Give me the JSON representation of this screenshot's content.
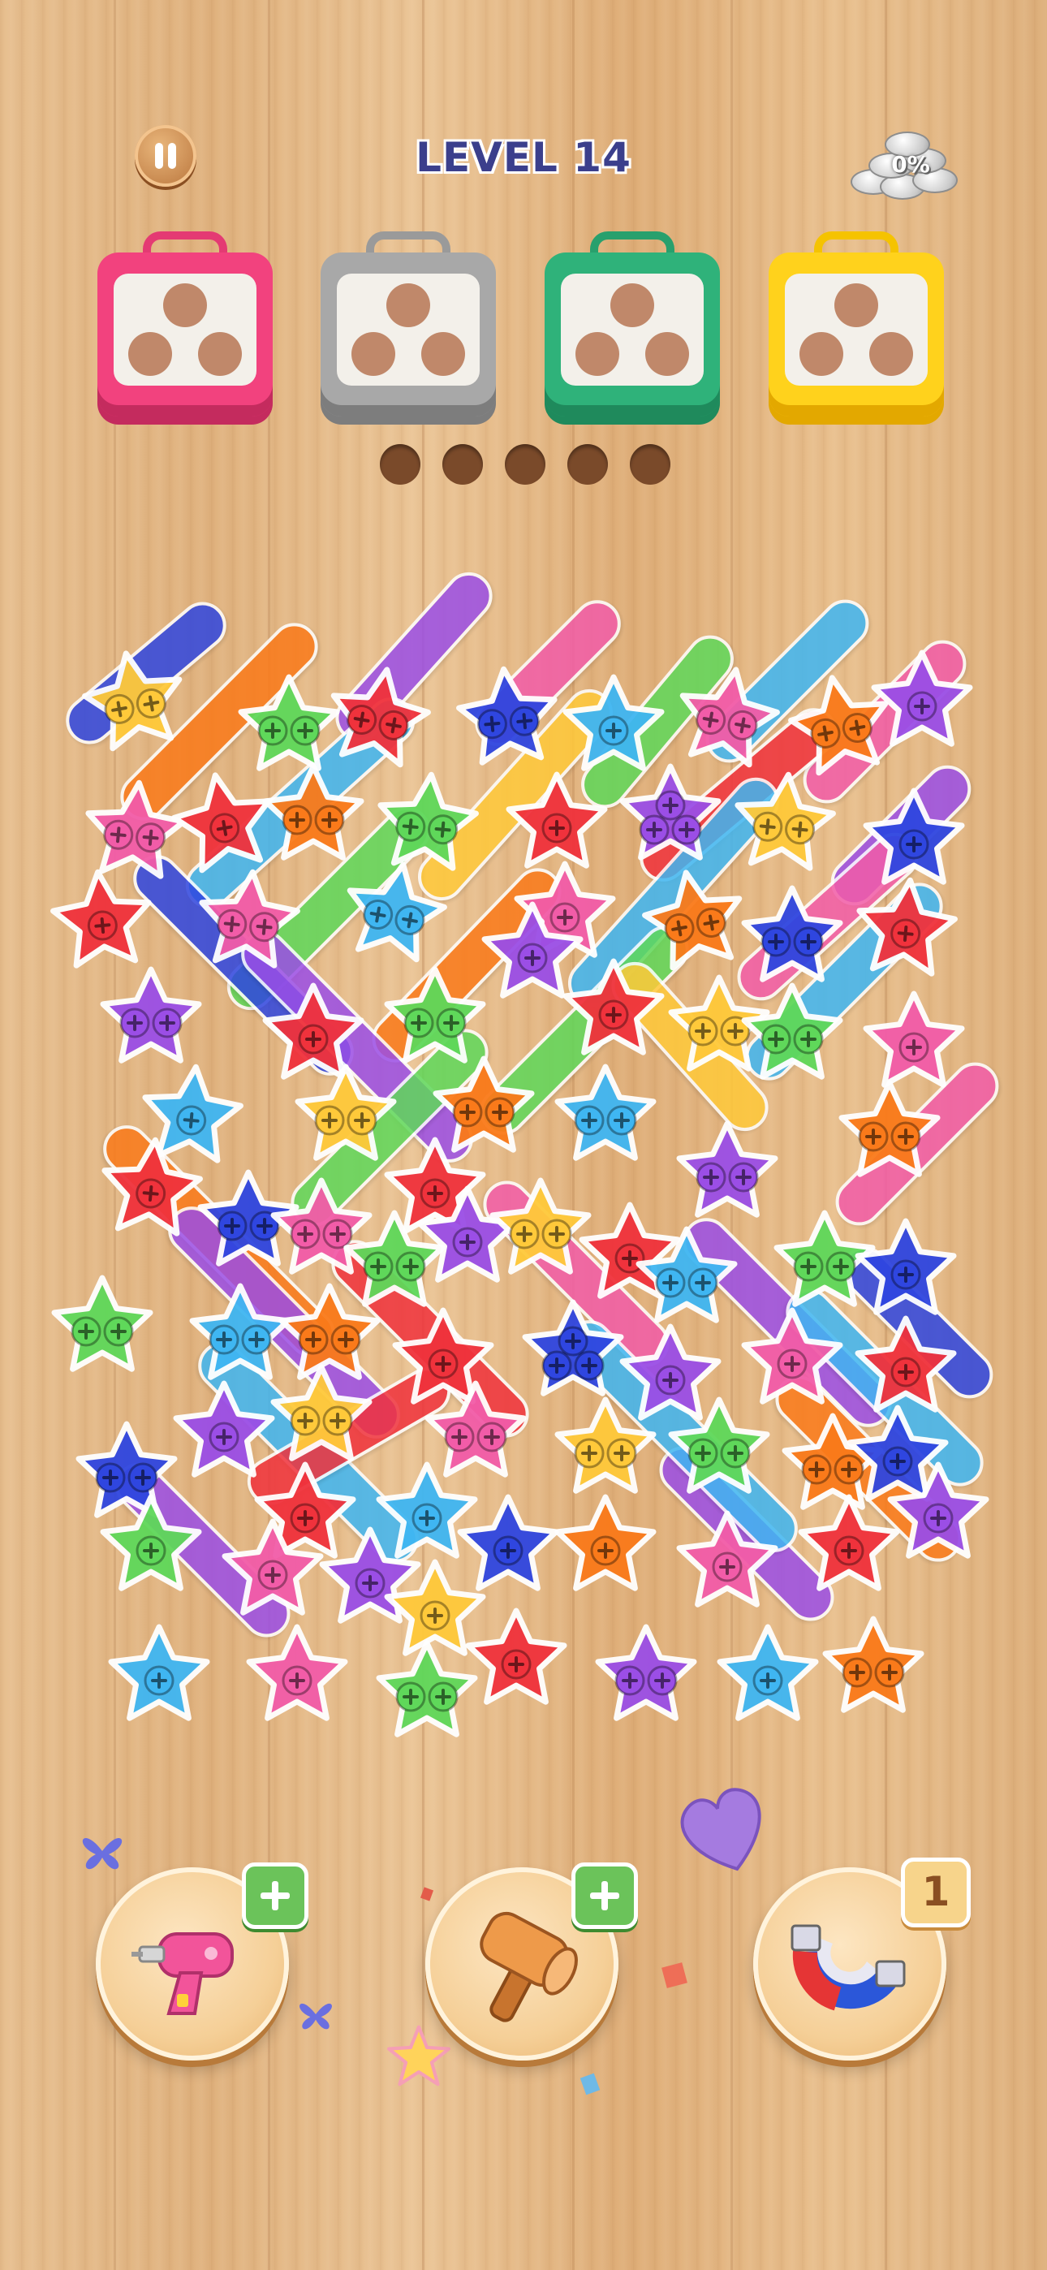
{
  "header": {
    "level_title": "LEVEL 14",
    "coin_progress": "0%"
  },
  "boxes": [
    {
      "name": "pink",
      "color": "#f2427e",
      "dark": "#c42b5e",
      "handle": "#e43a73"
    },
    {
      "name": "gray",
      "color": "#a8a8a8",
      "dark": "#7d7d7d",
      "handle": "#9a9a9a"
    },
    {
      "name": "green",
      "color": "#2fb27a",
      "dark": "#1f8a5c",
      "handle": "#28a06d"
    },
    {
      "name": "yellow",
      "color": "#ffd21c",
      "dark": "#e3a800",
      "handle": "#f5c300"
    }
  ],
  "holding_slots": 5,
  "tools": {
    "drill": {
      "badge": "+"
    },
    "hammer": {
      "badge": "+"
    },
    "magnet": {
      "count": "1"
    }
  },
  "colors": {
    "red": "#f0323c",
    "blue": "#2f46e0",
    "purple": "#9b4ee6",
    "green": "#5fd85a",
    "orange": "#fa7a1a",
    "yellow": "#ffc93a",
    "pink": "#f25ca8",
    "cyan": "#3fb6f2"
  }
}
